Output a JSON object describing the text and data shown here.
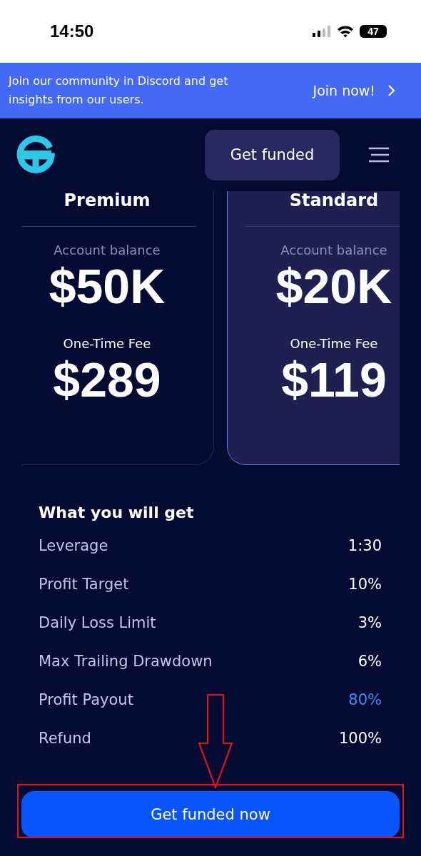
{
  "status_bar": {
    "time": "14:50",
    "battery": "47"
  },
  "banner": {
    "text": "Join our community in Discord and get insights from our users.",
    "action": "Join now!"
  },
  "header": {
    "button": "Get funded"
  },
  "plans": [
    {
      "name": "Premium",
      "balance_label": "Account balance",
      "balance": "$50K",
      "fee_label": "One-Time Fee",
      "fee": "$289",
      "selected": false
    },
    {
      "name": "Standard",
      "balance_label": "Account balance",
      "balance": "$20K",
      "fee_label": "One-Time Fee",
      "fee": "$119",
      "selected": true
    }
  ],
  "features": {
    "title": "What you will get",
    "rows": [
      {
        "label": "Leverage",
        "value": "1:30",
        "highlighted": false
      },
      {
        "label": "Profit Target",
        "value": "10%",
        "highlighted": false
      },
      {
        "label": "Daily Loss Limit",
        "value": "3%",
        "highlighted": false
      },
      {
        "label": "Max Trailing Drawdown",
        "value": "6%",
        "highlighted": false
      },
      {
        "label": "Profit Payout",
        "value": "80%",
        "highlighted": true
      },
      {
        "label": "Refund",
        "value": "100%",
        "highlighted": false
      }
    ]
  },
  "cta": {
    "label": "Get funded now"
  }
}
